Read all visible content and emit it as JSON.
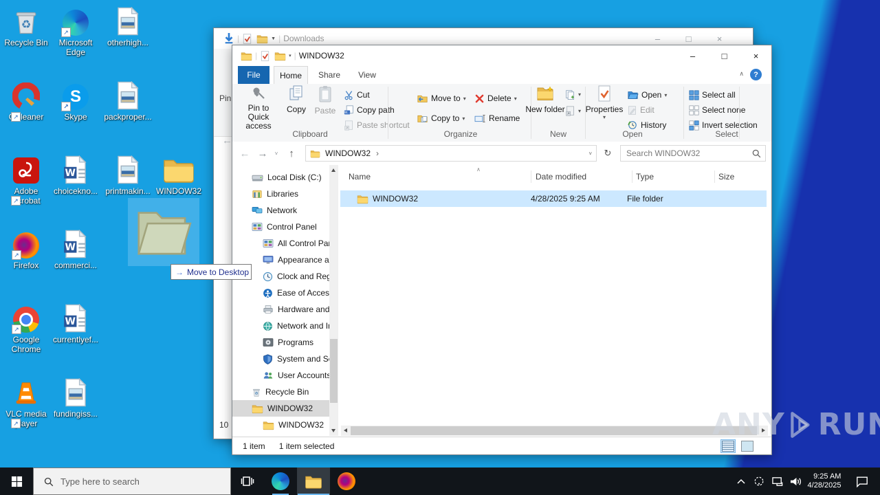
{
  "colors": {
    "desktop_light": "#17a0e2",
    "desktop_dark": "#1731ae",
    "selection_row": "#cce8ff",
    "file_tab": "#1666b0",
    "taskbar": "#11151a",
    "tree_selection": "#d9d9d9"
  },
  "desktop": {
    "icons": [
      {
        "label": "Recycle Bin"
      },
      {
        "label": "Microsoft Edge"
      },
      {
        "label": "otherhigh..."
      },
      {
        "label": "CCleaner"
      },
      {
        "label": "Skype"
      },
      {
        "label": "packproper..."
      },
      {
        "label": "Adobe Acrobat"
      },
      {
        "label": "choicekno..."
      },
      {
        "label": "printmakin..."
      },
      {
        "label": "WINDOW32"
      },
      {
        "label": "Firefox"
      },
      {
        "label": "commerci..."
      },
      {
        "label": "Google Chrome"
      },
      {
        "label": "currentlyef..."
      },
      {
        "label": "VLC media player"
      },
      {
        "label": "fundingiss..."
      }
    ],
    "drag": {
      "arrow": "→",
      "tooltip": "Move to Desktop"
    }
  },
  "background_window": {
    "title": "Downloads",
    "fragments": {
      "pin": "Pin",
      "back": "←",
      "count": "10"
    },
    "controls": {
      "minimize": "–",
      "maximize": "□",
      "close": "×"
    }
  },
  "explorer": {
    "title": "WINDOW32",
    "controls": {
      "minimize": "–",
      "maximize": "□",
      "close": "×"
    },
    "tabs": {
      "file": "File",
      "home": "Home",
      "share": "Share",
      "view": "View"
    },
    "glyphs": {
      "caret": "▾",
      "collapse": "∧",
      "help": "?",
      "crumb": "›",
      "sort": "∧",
      "back": "←",
      "forward": "→",
      "up": "↑",
      "dropdown": "˅",
      "refresh": "↻"
    },
    "ribbon": {
      "pin": "Pin to Quick access",
      "copy": "Copy",
      "paste": "Paste",
      "cut": "Cut",
      "copy_path": "Copy path",
      "paste_shortcut": "Paste shortcut",
      "clipboard_group": "Clipboard",
      "move_to": "Move to",
      "copy_to": "Copy to",
      "delete": "Delete",
      "rename": "Rename",
      "organize_group": "Organize",
      "new_folder": "New folder",
      "new_group": "New",
      "properties": "Properties",
      "open": "Open",
      "edit": "Edit",
      "history": "History",
      "open_group": "Open",
      "select_all": "Select all",
      "select_none": "Select none",
      "invert_selection": "Invert selection",
      "select_group": "Select"
    },
    "address": {
      "path": "WINDOW32",
      "search_placeholder": "Search WINDOW32"
    },
    "nav": {
      "items": [
        {
          "label": "Local Disk (C:)"
        },
        {
          "label": "Libraries"
        },
        {
          "label": "Network"
        },
        {
          "label": "Control Panel"
        },
        {
          "label": "All Control Par"
        },
        {
          "label": "Appearance an"
        },
        {
          "label": "Clock and Regi"
        },
        {
          "label": "Ease of Access"
        },
        {
          "label": "Hardware and"
        },
        {
          "label": "Network and Ir"
        },
        {
          "label": "Programs"
        },
        {
          "label": "System and Se"
        },
        {
          "label": "User Accounts"
        },
        {
          "label": "Recycle Bin"
        },
        {
          "label": "WINDOW32"
        },
        {
          "label": "WINDOW32"
        }
      ]
    },
    "list": {
      "columns": [
        "Name",
        "Date modified",
        "Type",
        "Size"
      ],
      "rows": [
        {
          "name": "WINDOW32",
          "date_modified": "4/28/2025 9:25 AM",
          "type": "File folder",
          "size": ""
        }
      ]
    },
    "status": {
      "items": "1 item",
      "selected": "1 item selected"
    }
  },
  "taskbar": {
    "search_placeholder": "Type here to search",
    "tray": {
      "time": "9:25 AM",
      "date": "4/28/2025"
    }
  },
  "watermark": {
    "left": "ANY",
    "right": "RUN"
  }
}
